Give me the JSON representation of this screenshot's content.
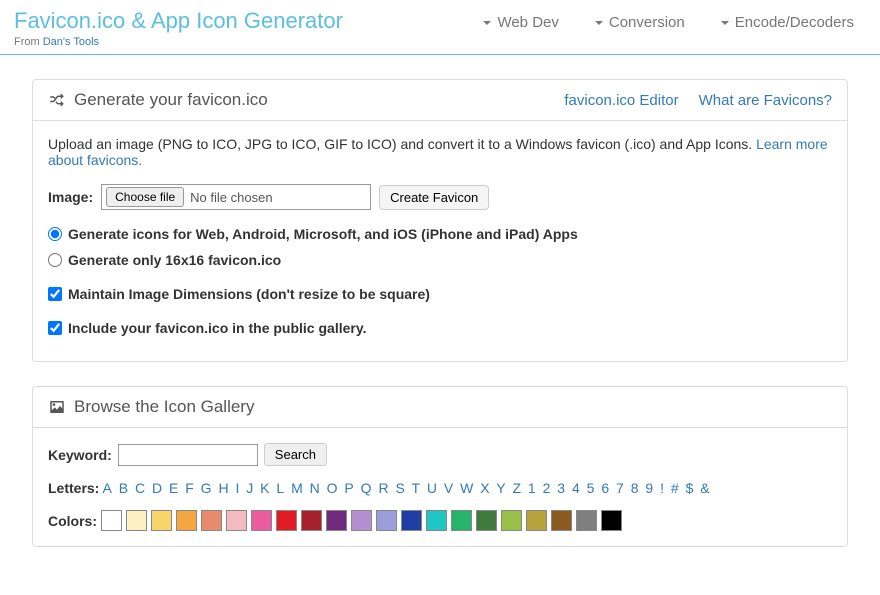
{
  "header": {
    "title": "Favicon.ico & App Icon Generator",
    "from_prefix": "From ",
    "from_link": "Dan's Tools",
    "nav": {
      "webdev": "Web Dev",
      "conversion": "Conversion",
      "encode": "Encode/Decoders"
    }
  },
  "panel1": {
    "heading": "Generate your favicon.ico",
    "link_editor": "favicon.ico Editor",
    "link_what": "What are Favicons?",
    "intro_before": "Upload an image (PNG to ICO, JPG to ICO, GIF to ICO) and convert it to a Windows favicon (.ico) and App Icons. ",
    "intro_link": "Learn more about favicons.",
    "image_label": "Image:",
    "choose_file": "Choose file",
    "file_status": "No file chosen",
    "create_btn": "Create Favicon",
    "opt_full": "Generate icons for Web, Android, Microsoft, and iOS (iPhone and iPad) Apps",
    "opt_16": "Generate only 16x16 favicon.ico",
    "opt_maintain": "Maintain Image Dimensions (don't resize to be square)",
    "opt_gallery": "Include your favicon.ico in the public gallery."
  },
  "panel2": {
    "heading": "Browse the Icon Gallery",
    "keyword_label": "Keyword:",
    "search_btn": "Search",
    "letters_label": "Letters:",
    "letters": [
      "A",
      "B",
      "C",
      "D",
      "E",
      "F",
      "G",
      "H",
      "I",
      "J",
      "K",
      "L",
      "M",
      "N",
      "O",
      "P",
      "Q",
      "R",
      "S",
      "T",
      "U",
      "V",
      "W",
      "X",
      "Y",
      "Z",
      "1",
      "2",
      "3",
      "4",
      "5",
      "6",
      "7",
      "8",
      "9",
      "!",
      "#",
      "$",
      "&"
    ],
    "colors_label": "Colors:",
    "colors": [
      "#ffffff",
      "#fdf0c2",
      "#f8d56a",
      "#f4a641",
      "#e88a6c",
      "#f4bcc0",
      "#ec5aa0",
      "#e01c24",
      "#a81f2e",
      "#6f2a7f",
      "#b38fd0",
      "#9a9edc",
      "#1f3fa6",
      "#1fc6c6",
      "#28b36a",
      "#3f7a3f",
      "#9ac04a",
      "#b6a33d",
      "#8a5a1f",
      "#7f7f7f",
      "#000000"
    ]
  }
}
